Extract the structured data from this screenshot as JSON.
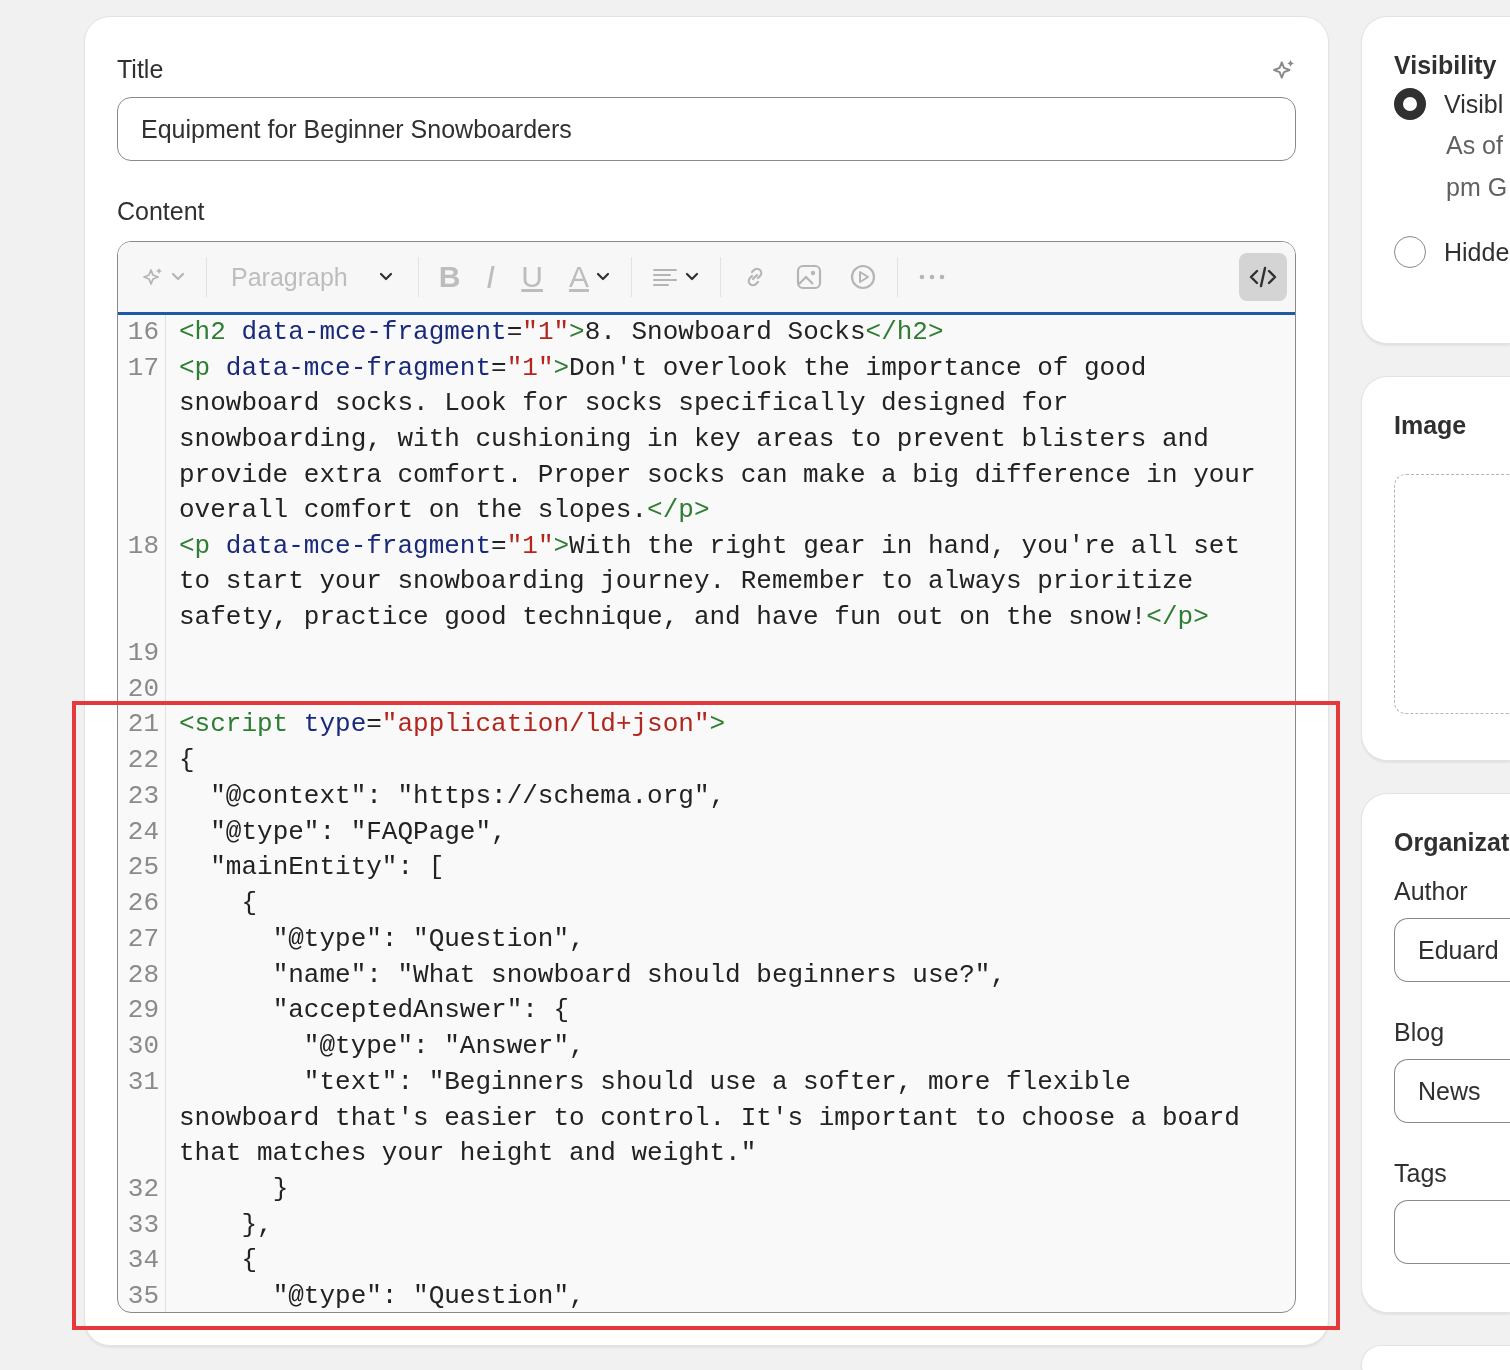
{
  "editor": {
    "title_label": "Title",
    "title_value": "Equipment for Beginner Snowboarders",
    "content_label": "Content",
    "toolbar": [
      {
        "kind": "ai",
        "disabled": true,
        "selected": false
      },
      {
        "kind": "format",
        "label": "Paragraph",
        "disabled": true,
        "selected": false
      },
      {
        "kind": "bold",
        "label": "B",
        "disabled": true,
        "selected": false
      },
      {
        "kind": "italic",
        "label": "I",
        "disabled": true,
        "selected": false
      },
      {
        "kind": "underline",
        "label": "U",
        "disabled": true,
        "selected": false
      },
      {
        "kind": "color",
        "label": "A",
        "disabled": true,
        "selected": false
      },
      {
        "kind": "align",
        "disabled": true,
        "selected": false
      },
      {
        "kind": "link",
        "disabled": true,
        "selected": false
      },
      {
        "kind": "image",
        "disabled": true,
        "selected": false
      },
      {
        "kind": "video",
        "disabled": true,
        "selected": false
      },
      {
        "kind": "more",
        "disabled": true,
        "selected": false
      },
      {
        "kind": "code",
        "disabled": false,
        "selected": true
      }
    ],
    "code_lines": [
      {
        "number": "16",
        "segments": [
          {
            "kind": "tag",
            "text": "<h2"
          },
          {
            "kind": "attr",
            "text": " data-mce-fragment"
          },
          {
            "kind": "text",
            "text": "="
          },
          {
            "kind": "value",
            "text": "\"1\""
          },
          {
            "kind": "tag",
            "text": ">"
          },
          {
            "kind": "text",
            "text": "8. Snowboard Socks"
          },
          {
            "kind": "tag",
            "text": "</h2>"
          }
        ]
      },
      {
        "number": "17",
        "segments": [
          {
            "kind": "tag",
            "text": "<p"
          },
          {
            "kind": "attr",
            "text": " data-mce-fragment"
          },
          {
            "kind": "text",
            "text": "="
          },
          {
            "kind": "value",
            "text": "\"1\""
          },
          {
            "kind": "tag",
            "text": ">"
          },
          {
            "kind": "text",
            "text": "Don't overlook the importance of good snowboard socks. Look for socks specifically designed for snowboarding, with cushioning in key areas to prevent blisters and provide extra comfort. Proper socks can make a big difference in your overall comfort on the slopes."
          },
          {
            "kind": "tag",
            "text": "</p>"
          }
        ]
      },
      {
        "number": "18",
        "segments": [
          {
            "kind": "tag",
            "text": "<p"
          },
          {
            "kind": "attr",
            "text": " data-mce-fragment"
          },
          {
            "kind": "text",
            "text": "="
          },
          {
            "kind": "value",
            "text": "\"1\""
          },
          {
            "kind": "tag",
            "text": ">"
          },
          {
            "kind": "text",
            "text": "With the right gear in hand, you're all set to start your snowboarding journey. Remember to always prioritize safety, practice good technique, and have fun out on the snow!"
          },
          {
            "kind": "tag",
            "text": "</p>"
          }
        ]
      },
      {
        "number": "19"
      },
      {
        "number": "20"
      },
      {
        "number": "21",
        "segments": [
          {
            "kind": "tag",
            "text": "<script"
          },
          {
            "kind": "attr",
            "text": " type"
          },
          {
            "kind": "text",
            "text": "="
          },
          {
            "kind": "value",
            "text": "\"application/ld+json\""
          },
          {
            "kind": "tag",
            "text": ">"
          }
        ]
      },
      {
        "number": "22",
        "segments": [
          {
            "kind": "text",
            "text": "{"
          }
        ]
      },
      {
        "number": "23",
        "segments": [
          {
            "kind": "text",
            "text": "  \"@context\": \"https://schema.org\","
          }
        ]
      },
      {
        "number": "24",
        "segments": [
          {
            "kind": "text",
            "text": "  \"@type\": \"FAQPage\","
          }
        ]
      },
      {
        "number": "25",
        "segments": [
          {
            "kind": "text",
            "text": "  \"mainEntity\": ["
          }
        ]
      },
      {
        "number": "26",
        "segments": [
          {
            "kind": "text",
            "text": "    {"
          }
        ]
      },
      {
        "number": "27",
        "segments": [
          {
            "kind": "text",
            "text": "      \"@type\": \"Question\","
          }
        ]
      },
      {
        "number": "28",
        "segments": [
          {
            "kind": "text",
            "text": "      \"name\": \"What snowboard should beginners use?\","
          }
        ]
      },
      {
        "number": "29",
        "segments": [
          {
            "kind": "text",
            "text": "      \"acceptedAnswer\": {"
          }
        ]
      },
      {
        "number": "30",
        "segments": [
          {
            "kind": "text",
            "text": "        \"@type\": \"Answer\","
          }
        ]
      },
      {
        "number": "31",
        "segments": [
          {
            "kind": "text",
            "text": "        \"text\": \"Beginners should use a softer, more flexible snowboard that's easier to control. It's important to choose a board that matches your height and weight.\""
          }
        ]
      },
      {
        "number": "32",
        "segments": [
          {
            "kind": "text",
            "text": "      }"
          }
        ]
      },
      {
        "number": "33",
        "segments": [
          {
            "kind": "text",
            "text": "    },"
          }
        ]
      },
      {
        "number": "34",
        "segments": [
          {
            "kind": "text",
            "text": "    {"
          }
        ]
      },
      {
        "number": "35",
        "segments": [
          {
            "kind": "text",
            "text": "      \"@type\": \"Question\","
          }
        ]
      }
    ]
  },
  "sidebar": {
    "visibility": {
      "heading": "Visibility",
      "options": [
        {
          "label": "Visibl",
          "selected": true,
          "note_lines": [
            "As of",
            "pm G"
          ]
        },
        {
          "label": "Hidde",
          "selected": false
        }
      ]
    },
    "image": {
      "heading": "Image"
    },
    "organization": {
      "heading": "Organizat",
      "fields": [
        {
          "label": "Author",
          "value": "Eduard"
        },
        {
          "label": "Blog",
          "value": "News"
        },
        {
          "label": "Tags"
        }
      ]
    }
  }
}
